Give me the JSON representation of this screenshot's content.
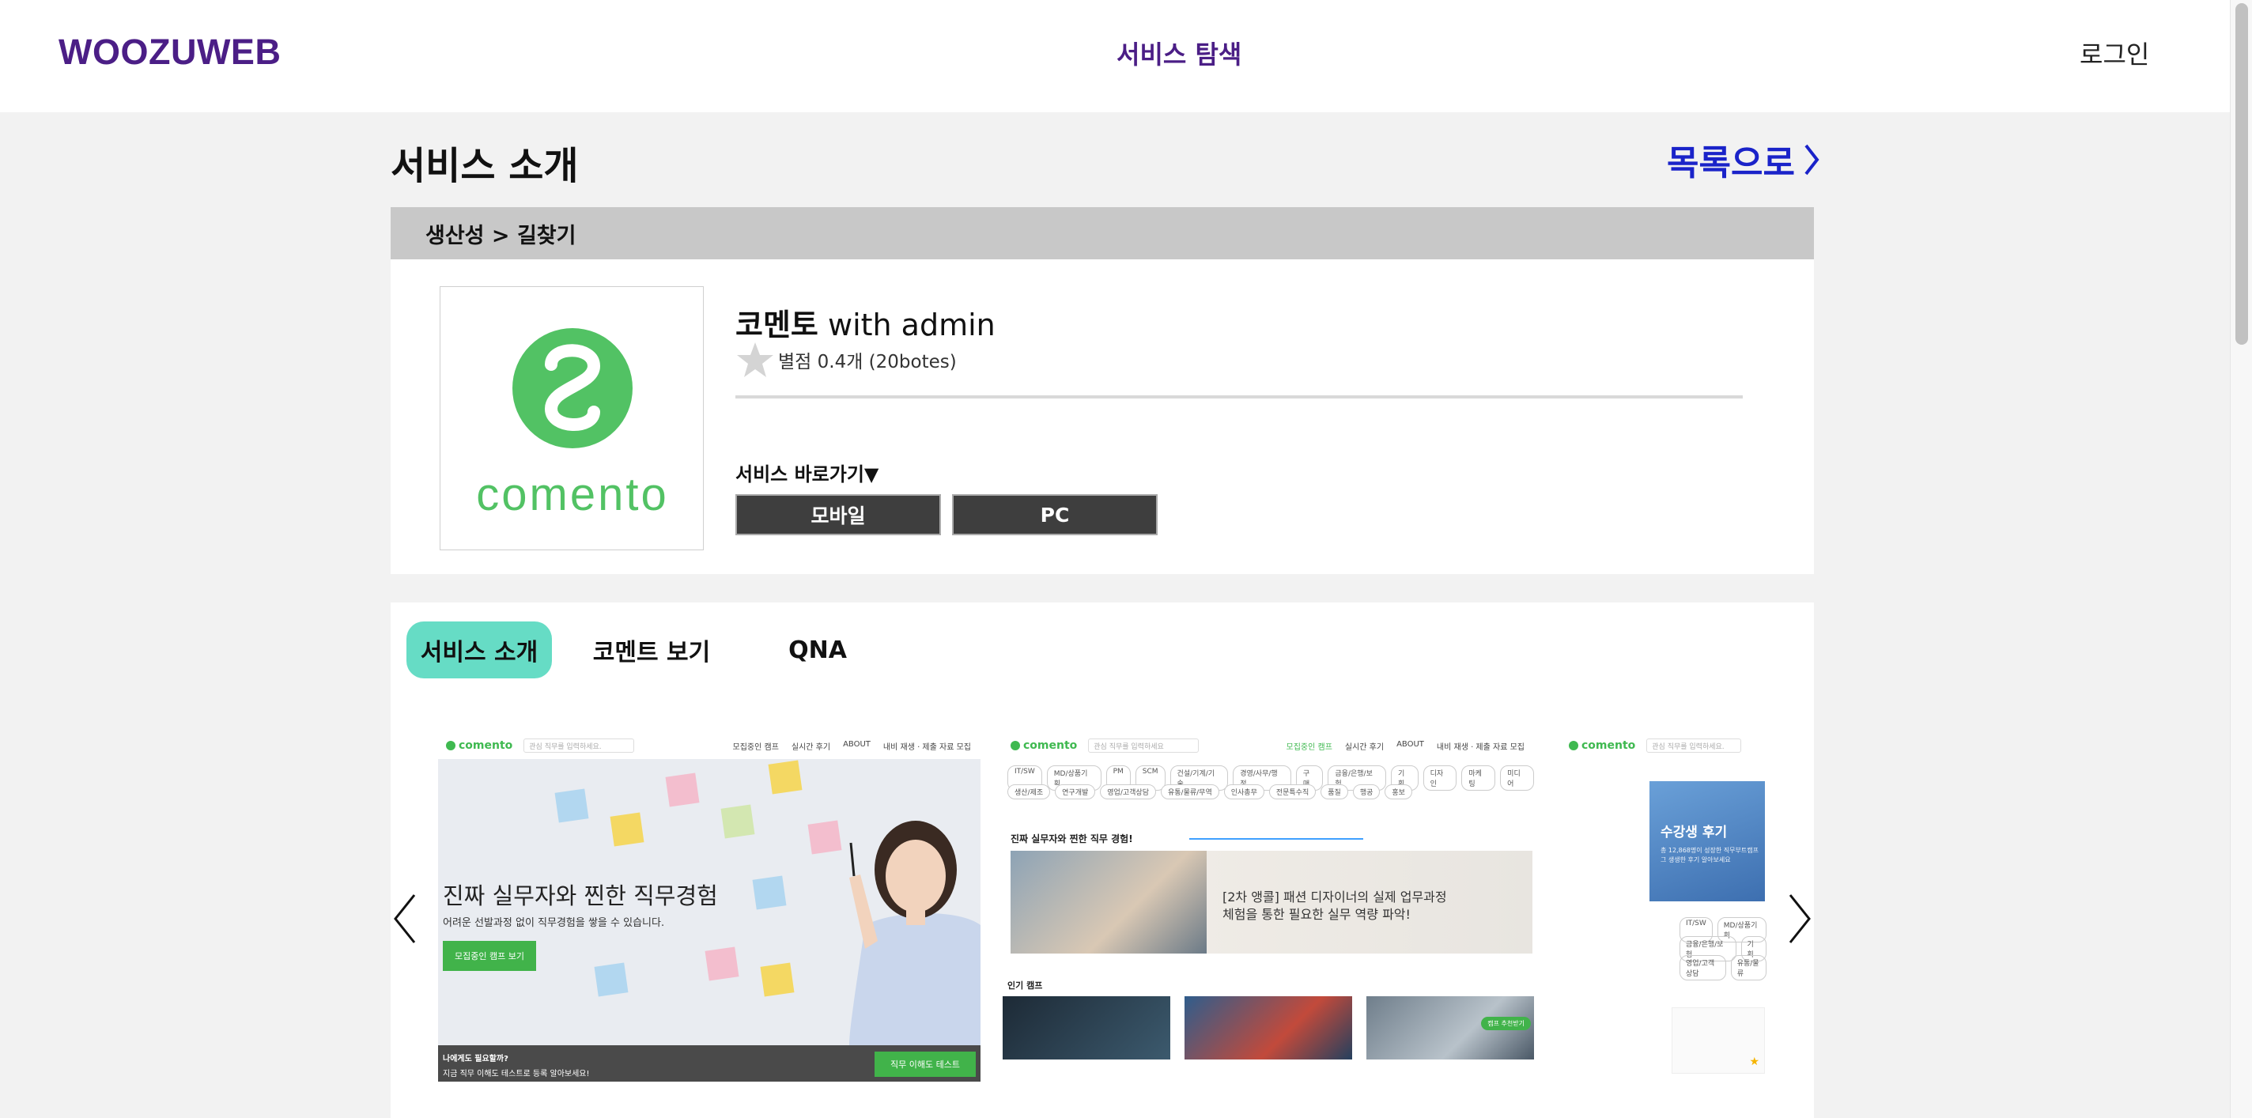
{
  "header": {
    "logo": "WOOZUWEB",
    "explore": "서비스 탐색",
    "login": "로그인"
  },
  "page": {
    "title": "서비스 소개",
    "back_link": "목록으로"
  },
  "breadcrumb": "생산성 > 길찾기",
  "service": {
    "name": "코멘토",
    "owner": "with admin",
    "rating_text": "별점 0.4개 (20botes)",
    "rating_value": 0.4,
    "logo_text": "comento",
    "brand_color": "#52c264",
    "shortcut_label": "서비스 바로가기▼",
    "buttons": {
      "mobile": "모바일",
      "pc": "PC"
    }
  },
  "tabs": [
    {
      "label": "서비스 소개",
      "active": true
    },
    {
      "label": "코멘트 보기",
      "active": false
    },
    {
      "label": "QNA",
      "active": false
    }
  ],
  "screenshots": {
    "shot1": {
      "logo": "comento",
      "search_placeholder": "관심 직무를 입력하세요.",
      "menu": [
        "모집중인 캠프",
        "실시간 후기",
        "ABOUT",
        "내비 재생 · 제출 자료 모집"
      ],
      "hero_title": "진짜 실무자와 찐한 직무경험",
      "hero_sub": "어려운 선발과정 없이 직무경험을 쌓을 수 있습니다.",
      "hero_button": "모집중인 캠프 보기",
      "footer_line1": "나에게도 필요할까?",
      "footer_line2": "지금 직무 이해도 테스트로 등록 알아보세요!",
      "footer_button": "직무 이해도 테스트"
    },
    "shot2": {
      "logo": "comento",
      "search_placeholder": "관심 직무를 입력하세요",
      "menu": [
        "모집중인 캠프",
        "실시간 후기",
        "ABOUT",
        "내비 재생 · 제출 자료 모집"
      ],
      "categories_row1": [
        "IT/SW",
        "MD/상품기획",
        "PM",
        "SCM",
        "건설/기계/기술",
        "경영/사무/행정",
        "구매",
        "금융/은행/보험",
        "기획",
        "디자인",
        "마케팅",
        "미디어"
      ],
      "categories_row2": [
        "생산/제조",
        "연구개발",
        "영업/고객상담",
        "유통/물류/무역",
        "인사총무",
        "전문특수직",
        "품질",
        "행공",
        "홍보"
      ],
      "promo_heading": "진짜 실무자와 찐한 직무 경험!",
      "promo_text_1": "[2차 앵콜] 패션 디자이너의 실제 업무과정",
      "promo_text_2": "체험을 통한 필요한 실무 역량 파악!",
      "popular_heading": "인기 캠프",
      "badge": "캠프 추천받기"
    },
    "shot3": {
      "logo": "comento",
      "search_placeholder": "관심 직무를 입력하세요.",
      "review_title": "수강생 후기",
      "review_sub": "총 12,868명이 성장한 직무부트캠프 그 생생한 후기 알아보세요",
      "chips_row1": [
        "IT/SW",
        "MD/상품기획"
      ],
      "chips_row2": [
        "금융/은행/보험",
        "기획"
      ],
      "chips_row3": [
        "영업/고객상담",
        "유통/물류"
      ]
    }
  },
  "colors": {
    "brand_purple": "#4b1e86",
    "link_blue": "#1a23c9",
    "tab_active": "#66dcc5",
    "button_dark": "#3e3e3e",
    "comento_green": "#52c264"
  }
}
